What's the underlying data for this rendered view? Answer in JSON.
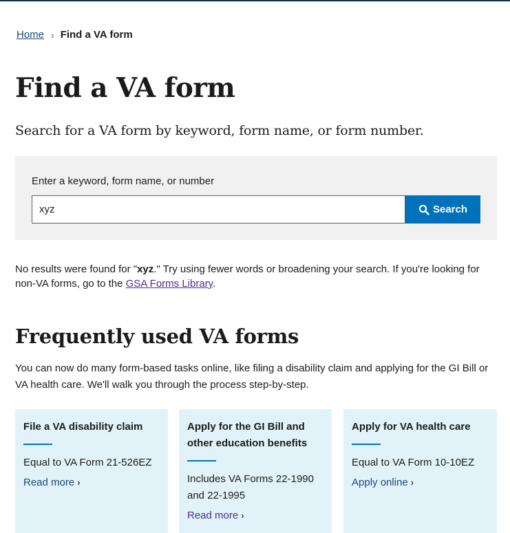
{
  "breadcrumb": {
    "home": "Home",
    "separator": "›",
    "current": "Find a VA form"
  },
  "page": {
    "title": "Find a VA form",
    "lead": "Search for a VA form by keyword, form name, or form number."
  },
  "search": {
    "label": "Enter a keyword, form name, or number",
    "value": "xyz",
    "button_label": "Search",
    "button_color": "#0071bb",
    "icon": "search-icon"
  },
  "results": {
    "prefix": "No results were found for \"",
    "query": "xyz",
    "middle": ".\" Try using fewer words or broadening your search. If you're looking for non-VA forms, go to the ",
    "link_text": "GSA Forms Library",
    "suffix": "."
  },
  "frequent": {
    "title": "Frequently used VA forms",
    "description": "You can now do many form-based tasks online, like filing a disability claim and applying for the GI Bill or VA health care. We'll walk you through the process step-by-step.",
    "cards": [
      {
        "title": "File a VA disability claim",
        "text": "Equal to VA Form 21-526EZ",
        "link": "Read more",
        "icon": "chevron-right-icon"
      },
      {
        "title": "Apply for the GI Bill and other education benefits",
        "text": "Includes VA Forms 22-1990 and 22-1995",
        "link": "Read more",
        "icon": "chevron-right-icon"
      },
      {
        "title": "Apply for VA health care",
        "text": "Equal to VA Form 10-10EZ",
        "link": "Apply online",
        "icon": "chevron-right-icon"
      }
    ]
  }
}
